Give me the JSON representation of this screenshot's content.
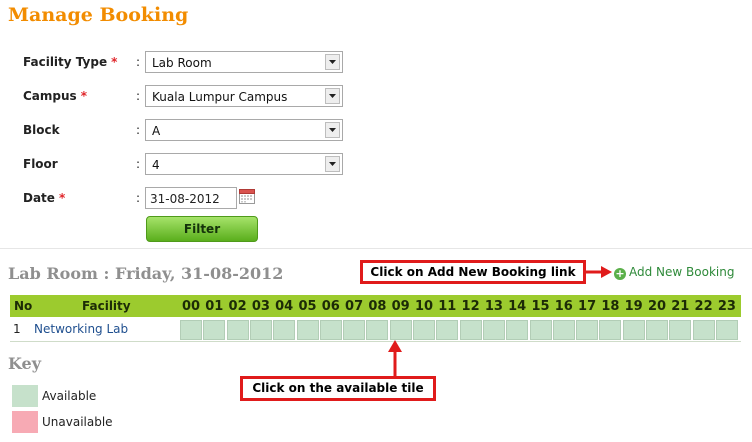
{
  "page": {
    "title": "Manage Booking"
  },
  "form": {
    "facility_type": {
      "label": "Facility Type",
      "required_mark": "*",
      "colon": ":",
      "value": "Lab Room"
    },
    "campus": {
      "label": "Campus",
      "required_mark": "*",
      "colon": ":",
      "value": "Kuala Lumpur Campus"
    },
    "block": {
      "label": "Block",
      "colon": ":",
      "value": "A"
    },
    "floor": {
      "label": "Floor",
      "colon": ":",
      "value": "4"
    },
    "date": {
      "label": "Date",
      "required_mark": "*",
      "colon": ":",
      "value": "31-08-2012",
      "icon": "calendar-icon"
    },
    "filter_label": "Filter"
  },
  "schedule": {
    "title": "Lab Room : Friday, 31-08-2012",
    "add_link": {
      "icon": "plus-circle-icon",
      "label": "Add New Booking"
    },
    "headers": {
      "no": "No",
      "facility": "Facility"
    },
    "hours": [
      "00",
      "01",
      "02",
      "03",
      "04",
      "05",
      "06",
      "07",
      "08",
      "09",
      "10",
      "11",
      "12",
      "13",
      "14",
      "15",
      "16",
      "17",
      "18",
      "19",
      "20",
      "21",
      "22",
      "23"
    ],
    "rows": [
      {
        "no": "1",
        "facility": "Networking Lab",
        "slots": [
          "available",
          "available",
          "available",
          "available",
          "available",
          "available",
          "available",
          "available",
          "available",
          "available",
          "available",
          "available",
          "available",
          "available",
          "available",
          "available",
          "available",
          "available",
          "available",
          "available",
          "available",
          "available",
          "available",
          "available"
        ]
      }
    ]
  },
  "key": {
    "title": "Key",
    "items": [
      {
        "label": "Available",
        "color": "#c6e1cb"
      },
      {
        "label": "Unavailable",
        "color": "#f7aab4"
      }
    ]
  },
  "annotations": {
    "add_booking": "Click on Add New Booking link",
    "tile": "Click on the available tile"
  },
  "colors": {
    "title": "#f28c00",
    "header_bar": "#9ccb2e",
    "callout_border": "#e01b1b"
  }
}
